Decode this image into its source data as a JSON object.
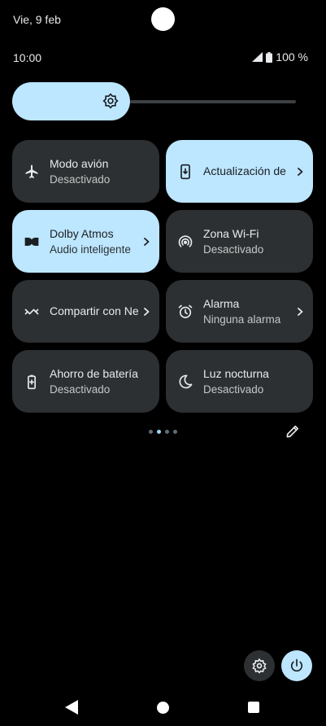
{
  "status_bar": {
    "date": "Vie, 9 feb",
    "time": "10:00",
    "battery": "100 %"
  },
  "brightness": {
    "level": 0.4
  },
  "tiles": [
    {
      "label": "Modo avión",
      "sub": "Desactivado",
      "state": "off",
      "icon": "airplane-icon"
    },
    {
      "label": "Actualización de",
      "sub": "",
      "state": "on",
      "icon": "system-update-icon",
      "chevron": true
    },
    {
      "label": "Dolby Atmos",
      "sub": "Audio inteligente",
      "state": "on",
      "icon": "dolby-icon",
      "chevron": true
    },
    {
      "label": "Zona Wi-Fi",
      "sub": "Desactivado",
      "state": "off",
      "icon": "hotspot-icon"
    },
    {
      "label": "Compartir con Nearby",
      "sub": "",
      "state": "off",
      "icon": "nearby-share-icon",
      "chevron": true
    },
    {
      "label": "Alarma",
      "sub": "Ninguna alarma",
      "state": "off",
      "icon": "alarm-icon",
      "chevron": true
    },
    {
      "label": "Ahorro de batería",
      "sub": "Desactivado",
      "state": "off",
      "icon": "battery-saver-icon"
    },
    {
      "label": "Luz nocturna",
      "sub": "Desactivado",
      "state": "off",
      "icon": "night-light-icon"
    }
  ],
  "pager": {
    "pages": 4,
    "current": 2
  },
  "colors": {
    "accent": "#bde6ff",
    "tile_off": "#2d3033",
    "background": "#000000"
  }
}
